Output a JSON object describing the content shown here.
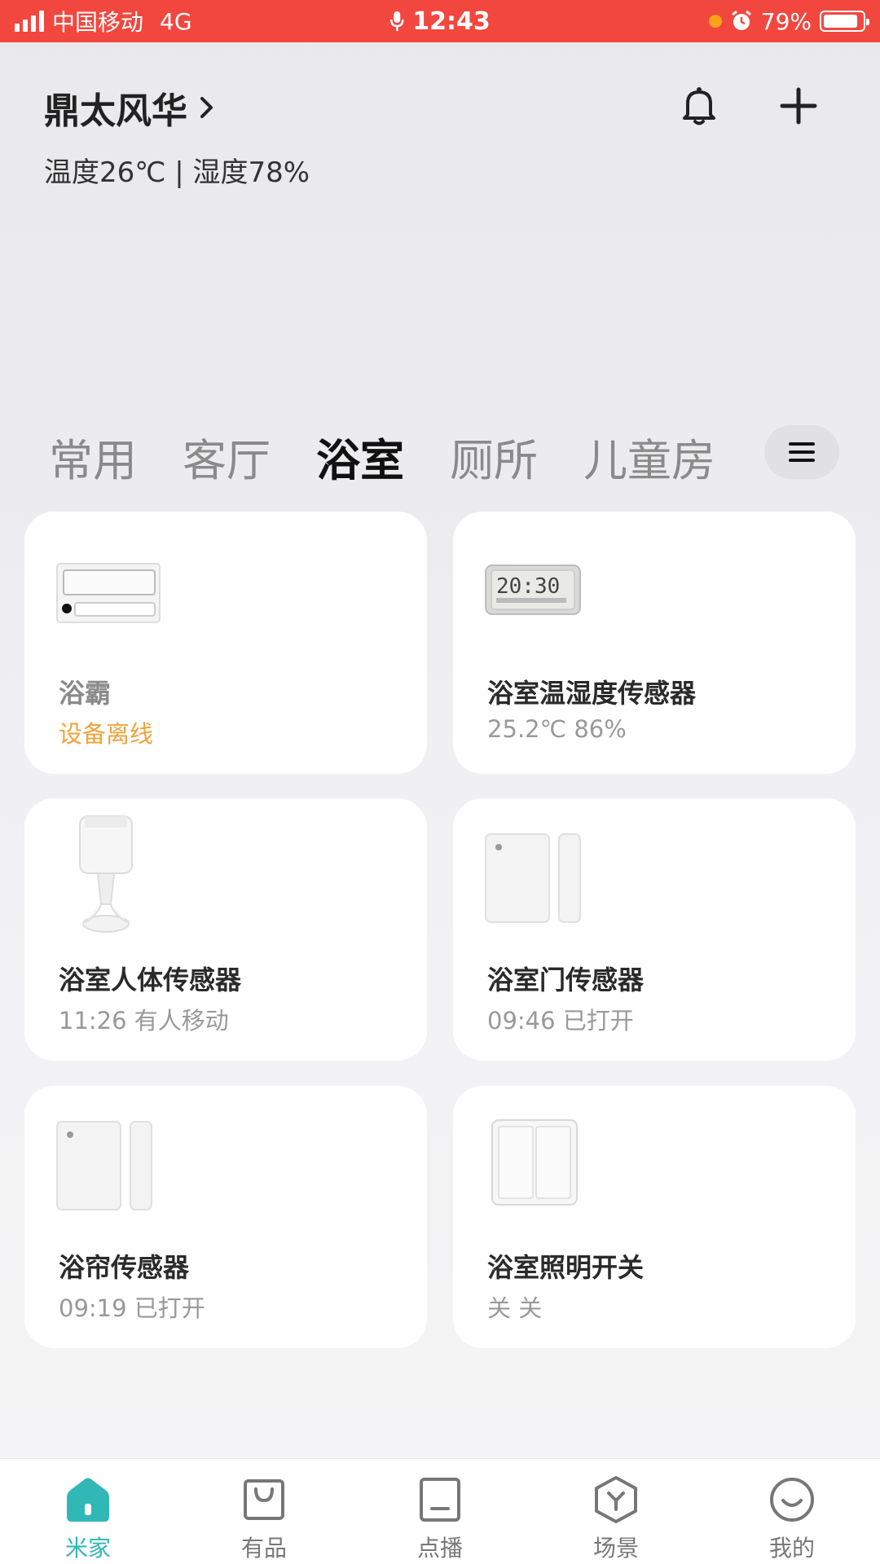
{
  "status_bar": {
    "carrier": "中国移动",
    "network": "4G",
    "time": "12:43",
    "battery": "79%"
  },
  "header": {
    "home_name": "鼎太风华",
    "climate": "温度26℃ | 湿度78%"
  },
  "tabs": [
    {
      "label": "常用"
    },
    {
      "label": "客厅"
    },
    {
      "label": "浴室"
    },
    {
      "label": "厕所"
    },
    {
      "label": "儿童房"
    }
  ],
  "active_tab": "浴室",
  "devices": [
    {
      "name": "浴霸",
      "status": "设备离线",
      "icon": "bath-heater-icon"
    },
    {
      "name": "浴室温湿度传感器",
      "status": "25.2℃ 86%",
      "icon": "thermo-hygrometer-icon",
      "display": "20:30"
    },
    {
      "name": "浴室人体传感器",
      "status": "11:26 有人移动",
      "icon": "motion-sensor-icon"
    },
    {
      "name": "浴室门传感器",
      "status": "09:46 已打开",
      "icon": "door-sensor-icon"
    },
    {
      "name": "浴帘传感器",
      "status": "09:19 已打开",
      "icon": "door-sensor-icon"
    },
    {
      "name": "浴室照明开关",
      "status": "关 关",
      "icon": "double-switch-icon"
    }
  ],
  "bottom_nav": [
    {
      "label": "米家",
      "icon": "home-icon"
    },
    {
      "label": "有品",
      "icon": "shopping-bag-icon"
    },
    {
      "label": "点播",
      "icon": "tablet-icon"
    },
    {
      "label": "场景",
      "icon": "scene-icon"
    },
    {
      "label": "我的",
      "icon": "smile-icon"
    }
  ],
  "colors": {
    "status_bar": "#f2473f",
    "accent": "#32b7b7",
    "offline": "#f0a23a"
  }
}
